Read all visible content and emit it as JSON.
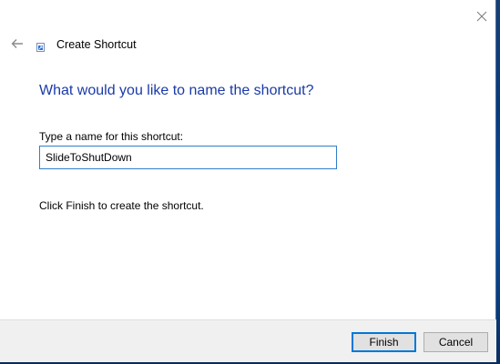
{
  "wizard": {
    "title": "Create Shortcut",
    "main_instruction": "What would you like to name the shortcut?",
    "name_label": "Type a name for this shortcut:",
    "name_value": "SlideToShutDown",
    "hint": "Click Finish to create the shortcut."
  },
  "buttons": {
    "finish_label": "Finish",
    "cancel_label": "Cancel"
  },
  "icons": {
    "close": "close-icon",
    "back": "back-arrow-icon",
    "app": "shortcut-icon"
  },
  "colors": {
    "instruction": "#1a3aa8",
    "focus_border": "#0078d7",
    "desktop": "#0b2a55"
  }
}
